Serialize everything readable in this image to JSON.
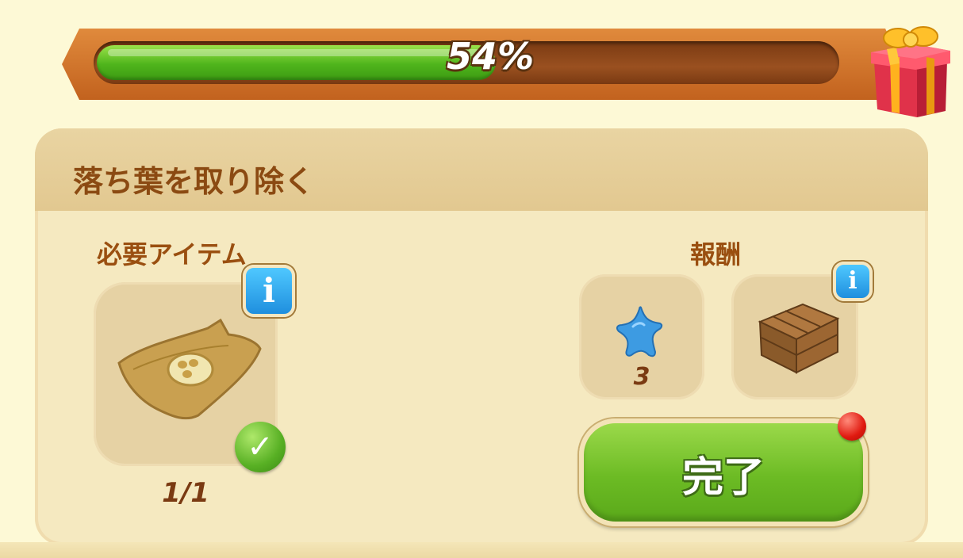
{
  "progress": {
    "percent_text": "54%",
    "value": 0.54,
    "reward_icon": "gift-box-icon"
  },
  "task": {
    "title": "落ち葉を取り除く",
    "required": {
      "label": "必要アイテム",
      "item_icon": "seed-bag-icon",
      "count": "1/1",
      "info_label": "i",
      "status_icon": "checkmark-icon"
    },
    "reward": {
      "label": "報酬",
      "items": [
        {
          "icon": "blue-star-icon",
          "count": "3"
        },
        {
          "icon": "wooden-crate-icon",
          "info_label": "i"
        }
      ]
    },
    "complete_button": "完了"
  },
  "colors": {
    "background": "#fdf9d6",
    "panel": "#f5e9c0",
    "title_text": "#8b4a12",
    "progress_fill": "#5bbd20",
    "button_green": "#78c22c",
    "info_blue": "#2a9be6",
    "notify_red": "#e01a10"
  }
}
